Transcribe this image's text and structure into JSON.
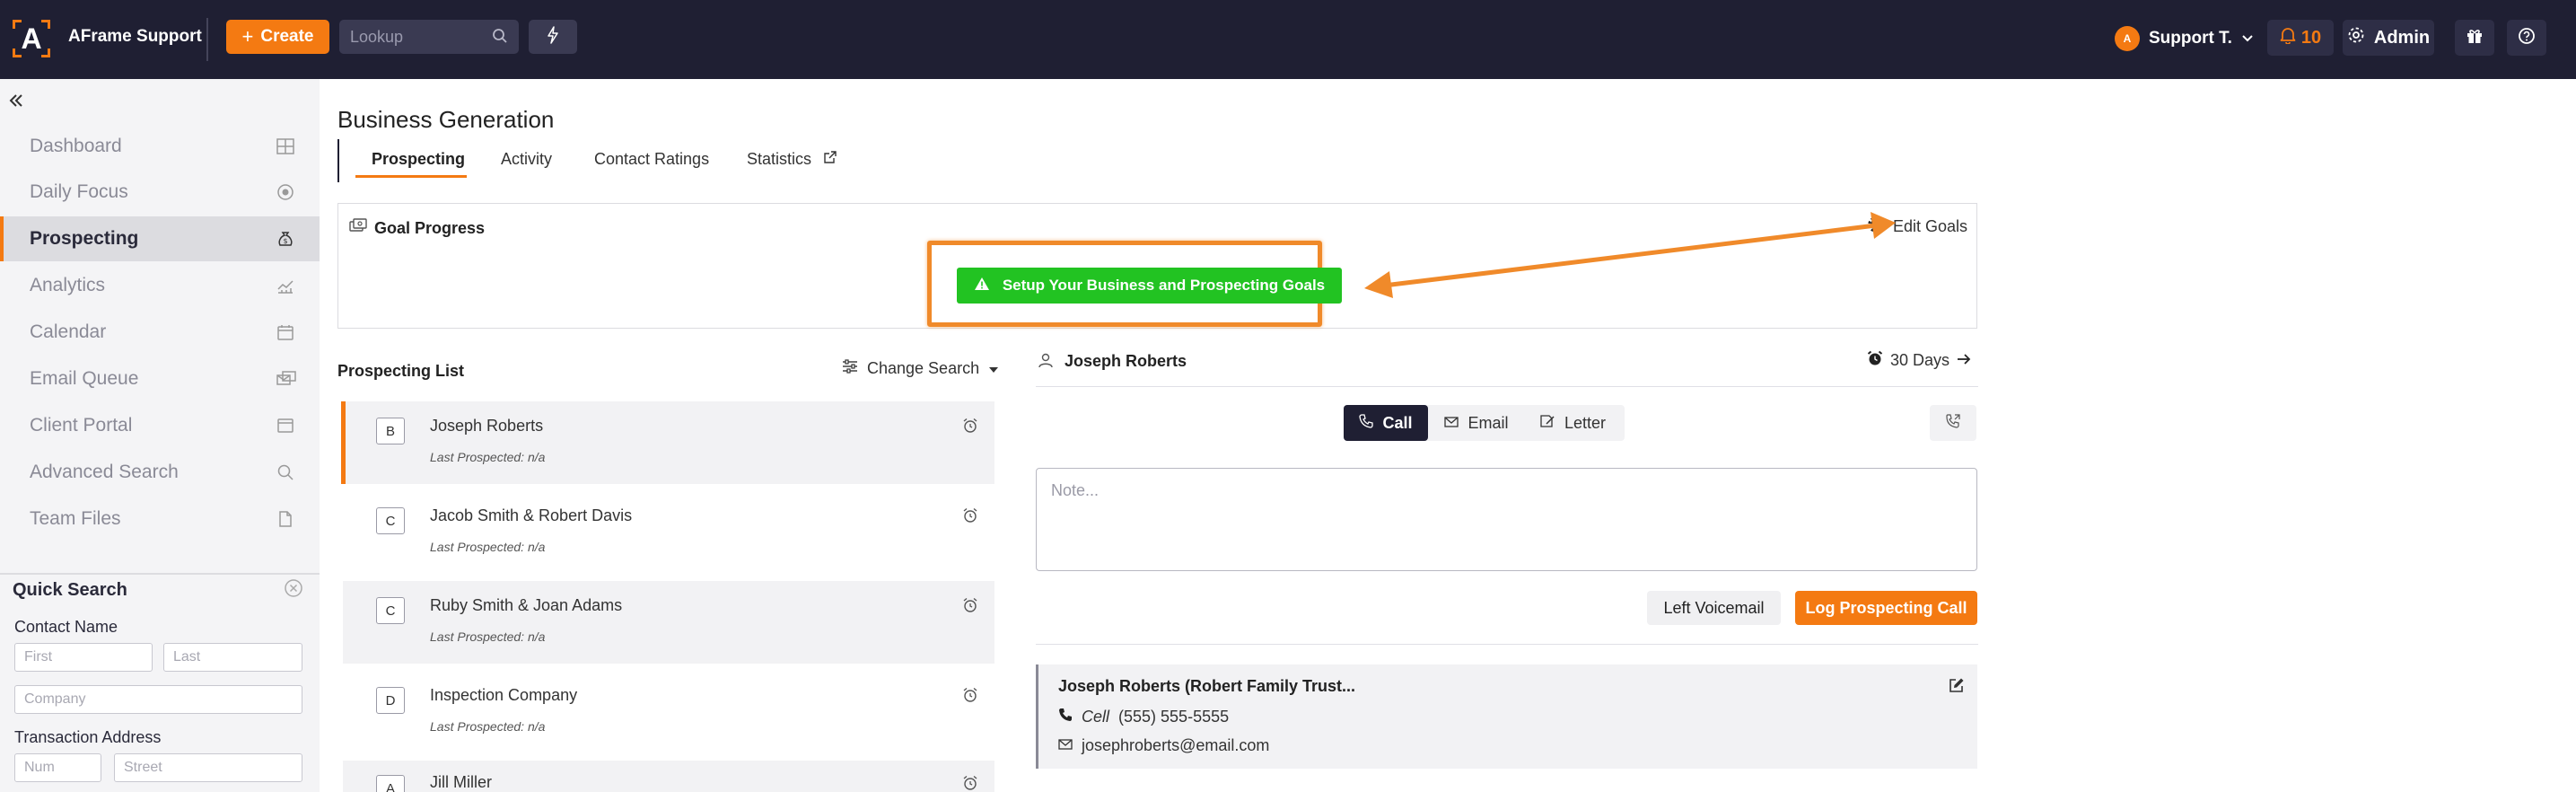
{
  "colors": {
    "brand": "#f47a12",
    "nav_bg": "#1f1f33",
    "success": "#22c322"
  },
  "topnav": {
    "logo_letter": "A",
    "app_name": "AFrame Support",
    "create_label": "Create",
    "lookup_placeholder": "Lookup",
    "user_initial": "A",
    "user_name": "Support T.",
    "notification_count": "10",
    "admin_label": "Admin",
    "icons": [
      "plus-icon",
      "search-icon",
      "bolt-icon",
      "chevron-down-icon",
      "bell-icon",
      "gear-icon",
      "gift-icon",
      "help-icon"
    ]
  },
  "sidebar": {
    "items": [
      {
        "label": "Dashboard",
        "icon": "grid-icon"
      },
      {
        "label": "Daily Focus",
        "icon": "target-icon"
      },
      {
        "label": "Prospecting",
        "icon": "money-bag-icon",
        "active": true
      },
      {
        "label": "Analytics",
        "icon": "chart-icon"
      },
      {
        "label": "Calendar",
        "icon": "calendar-icon"
      },
      {
        "label": "Email Queue",
        "icon": "email-queue-icon"
      },
      {
        "label": "Client Portal",
        "icon": "browser-icon"
      },
      {
        "label": "Advanced Search",
        "icon": "search-icon"
      },
      {
        "label": "Team Files",
        "icon": "file-icon"
      }
    ],
    "quick_search": {
      "title": "Quick Search",
      "contact_name_label": "Contact Name",
      "first_placeholder": "First",
      "last_placeholder": "Last",
      "company_placeholder": "Company",
      "address_label": "Transaction Address",
      "num_placeholder": "Num",
      "street_placeholder": "Street"
    }
  },
  "main": {
    "page_title": "Business Generation",
    "tabs": [
      {
        "label": "Prospecting",
        "active": true
      },
      {
        "label": "Activity"
      },
      {
        "label": "Contact Ratings"
      },
      {
        "label": "Statistics",
        "external": true
      }
    ],
    "goal": {
      "title": "Goal Progress",
      "edit_label": "Edit Goals",
      "setup_label": "Setup Your Business and Prospecting Goals"
    },
    "list": {
      "title": "Prospecting List",
      "change_search_label": "Change Search",
      "rows": [
        {
          "badge": "B",
          "name": "Joseph Roberts",
          "sub": "Last Prospected: n/a"
        },
        {
          "badge": "C",
          "name": "Jacob Smith & Robert Davis",
          "sub": "Last Prospected: n/a"
        },
        {
          "badge": "C",
          "name": "Ruby Smith & Joan Adams",
          "sub": "Last Prospected: n/a"
        },
        {
          "badge": "D",
          "name": "Inspection Company",
          "sub": "Last Prospected: n/a"
        },
        {
          "badge": "A",
          "name": "Jill Miller",
          "sub": ""
        }
      ]
    },
    "contact": {
      "name": "Joseph Roberts",
      "days_label": "30 Days",
      "segments": [
        "Call",
        "Email",
        "Letter"
      ],
      "note_placeholder": "Note...",
      "voicemail_label": "Left Voicemail",
      "log_call_label": "Log Prospecting Call",
      "card": {
        "title": "Joseph Roberts (Robert Family Trust...",
        "phone_type": "Cell",
        "phone": "(555) 555-5555",
        "email": "josephroberts@email.com"
      }
    }
  }
}
